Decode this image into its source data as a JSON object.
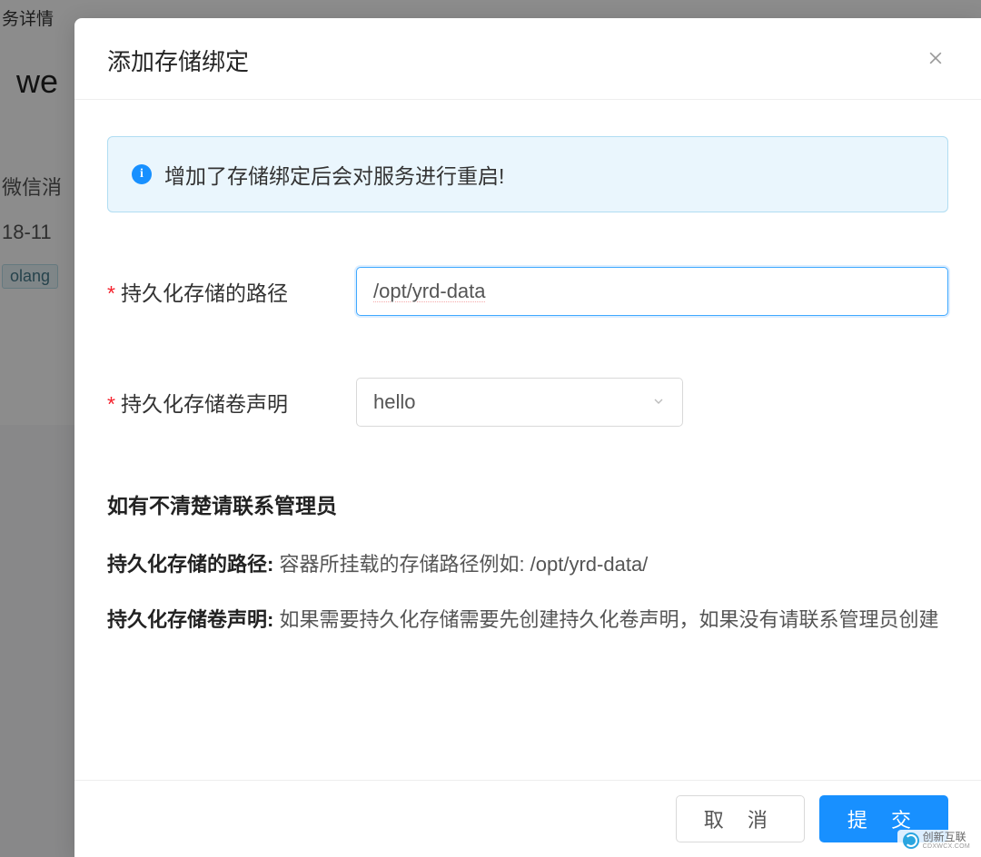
{
  "background": {
    "breadcrumb": "务详情",
    "title_fragment": "we",
    "line1": "微信消",
    "line2": "18-11",
    "tag": "olang"
  },
  "modal": {
    "title": "添加存储绑定",
    "alert_text": "增加了存储绑定后会对服务进行重启!",
    "form": {
      "path_label": "持久化存储的路径",
      "path_value": "/opt/yrd-data",
      "pvc_label": "持久化存储卷声明",
      "pvc_value": "hello"
    },
    "help": {
      "heading": "如有不清楚请联系管理员",
      "item1_label": "持久化存储的路径:",
      "item1_text": " 容器所挂载的存储路径例如: /opt/yrd-data/",
      "item2_label": "持久化存储卷声明:",
      "item2_text": " 如果需要持久化存储需要先创建持久化卷声明，如果没有请联系管理员创建"
    },
    "footer": {
      "cancel": "取 消",
      "submit": "提 交"
    }
  },
  "watermark": {
    "main": "创新互联",
    "sub": "CDXWCX.COM"
  }
}
